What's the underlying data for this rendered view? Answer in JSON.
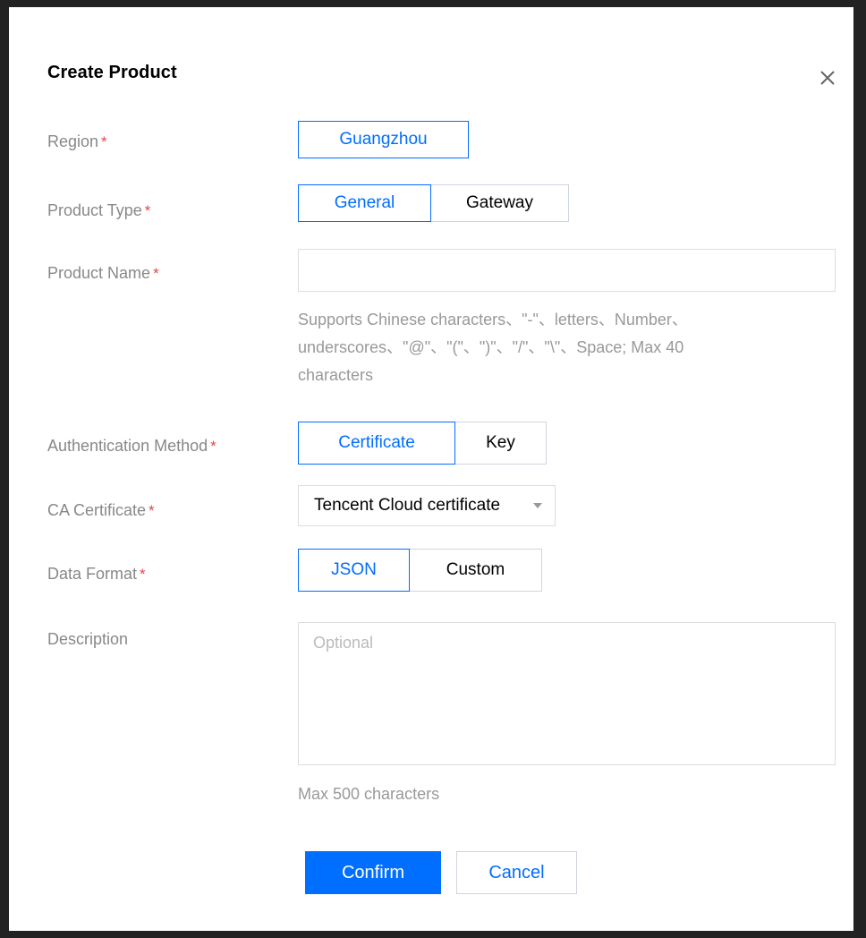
{
  "dialog": {
    "title": "Create Product",
    "close_icon": "close-icon"
  },
  "form": {
    "region": {
      "label": "Region",
      "required_mark": "*",
      "options": [
        "Guangzhou"
      ],
      "selected": "Guangzhou"
    },
    "product_type": {
      "label": "Product Type",
      "required_mark": "*",
      "options": [
        "General",
        "Gateway"
      ],
      "selected": "General"
    },
    "product_name": {
      "label": "Product Name",
      "required_mark": "*",
      "value": "",
      "help_line1": "Supports Chinese characters、\"-\"、letters、Number、",
      "help_line2": "underscores、\"@\"、\"(\"、\")\"、\"/\"、\"\\\"、Space; Max 40",
      "help_line3": "characters"
    },
    "auth_method": {
      "label": "Authentication Method",
      "required_mark": "*",
      "options": [
        "Certificate",
        "Key"
      ],
      "selected": "Certificate"
    },
    "ca_certificate": {
      "label": "CA Certificate",
      "required_mark": "*",
      "value": "Tencent Cloud certificate",
      "caret_icon": "caret-down-icon"
    },
    "data_format": {
      "label": "Data Format",
      "required_mark": "*",
      "options": [
        "JSON",
        "Custom"
      ],
      "selected": "JSON"
    },
    "description": {
      "label": "Description",
      "placeholder": "Optional",
      "value": "",
      "help": "Max 500 characters"
    }
  },
  "footer": {
    "confirm_label": "Confirm",
    "cancel_label": "Cancel"
  },
  "colors": {
    "accent": "#006eff",
    "required": "#e54545",
    "label": "#888888",
    "border": "#dddddd"
  }
}
